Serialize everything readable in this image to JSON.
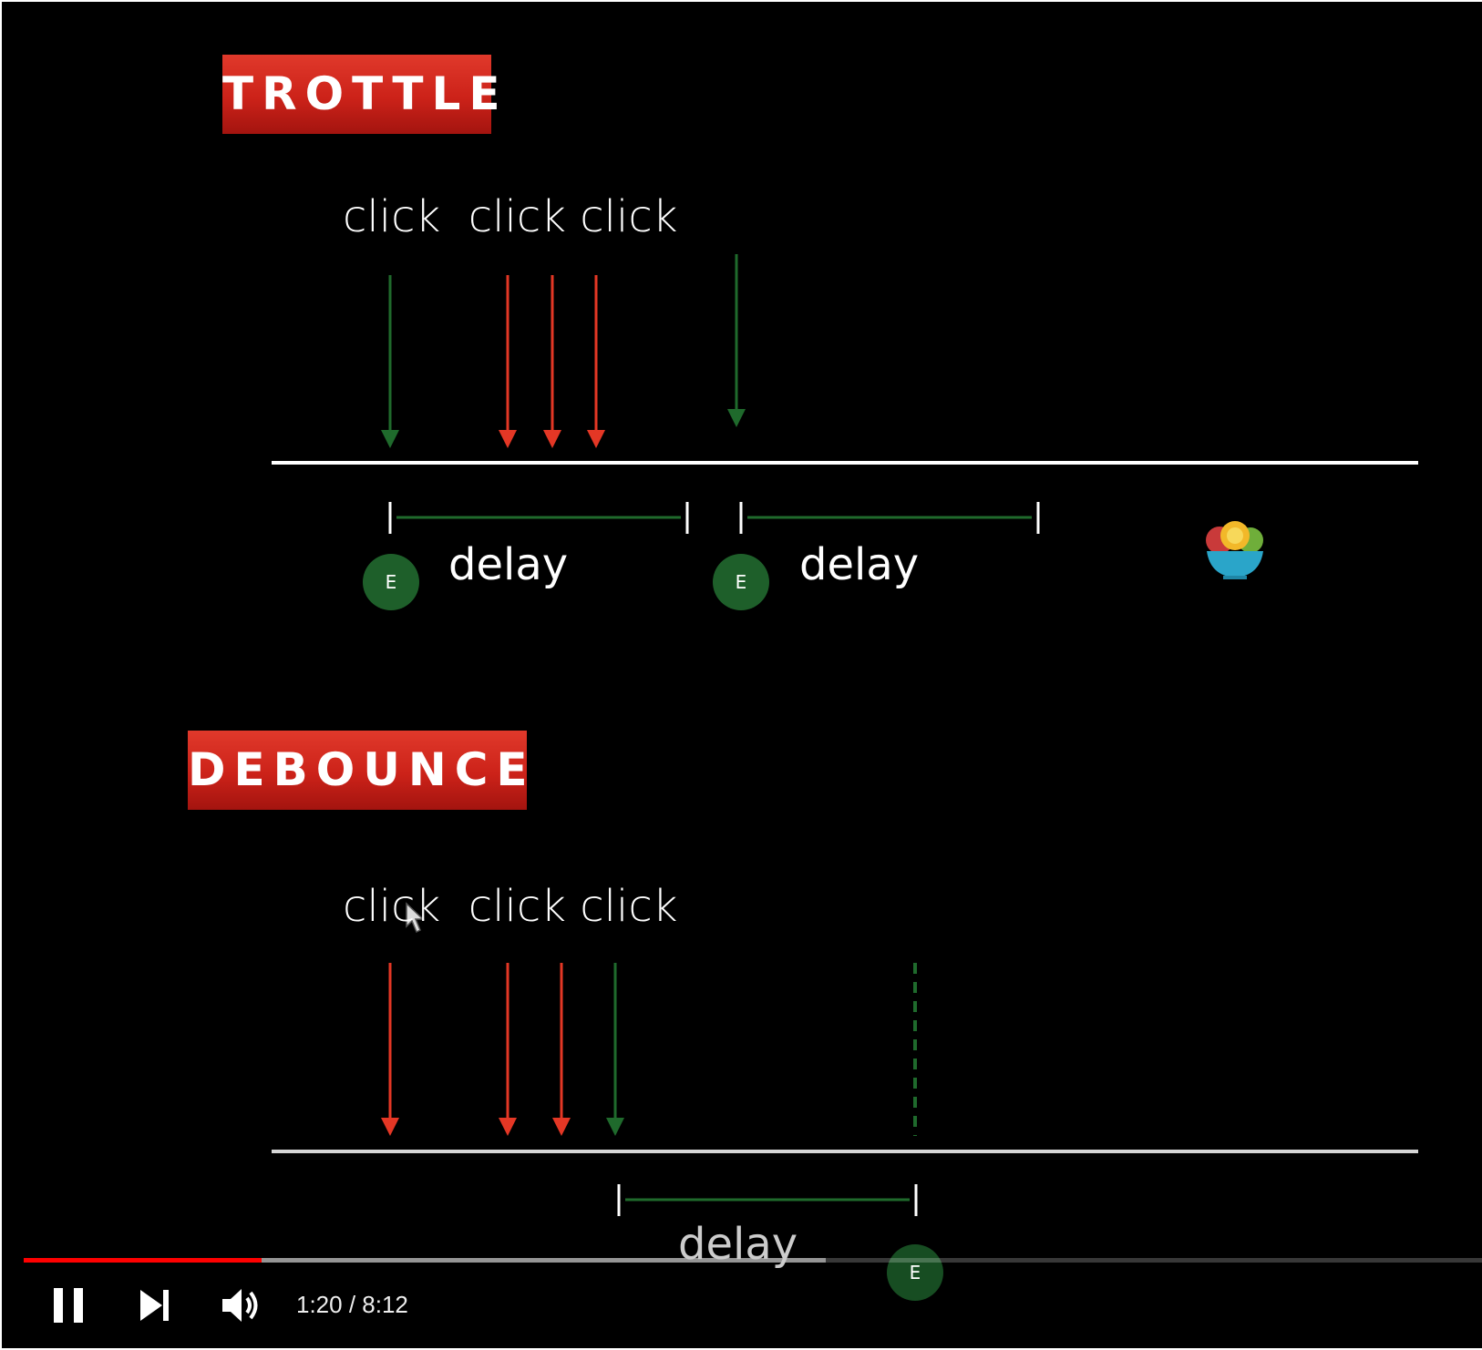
{
  "throttle": {
    "title": "TROTTLE",
    "clicks_label": "click  click click",
    "delay_labels": [
      "delay",
      "delay"
    ],
    "event_badge": "E"
  },
  "debounce": {
    "title": "DEBOUNCE",
    "clicks_label": "click  click click",
    "delay_label": "delay",
    "event_badge": "E"
  },
  "colors": {
    "red_arrow": "#e43725",
    "green_arrow": "#1f6a2c",
    "badge_red": "#cc2219",
    "timeline": "#ffffff",
    "progress_played": "#ff0000"
  },
  "icons": {
    "mascot": "salad-bowl-icon",
    "play_pause": "pause-icon",
    "next": "next-icon",
    "volume": "volume-icon"
  },
  "player": {
    "current_time": "1:20",
    "duration": "8:12",
    "time_display": "1:20 / 8:12",
    "progress_fraction": 0.163,
    "buffered_fraction": 0.55
  }
}
